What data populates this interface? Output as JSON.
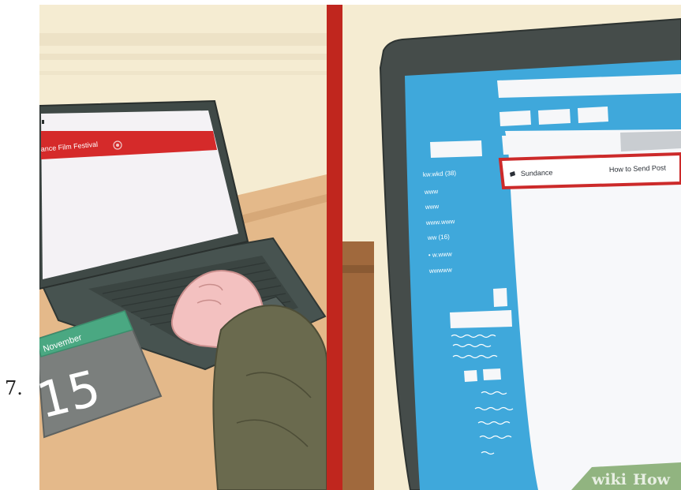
{
  "step_number": "7.",
  "left_panel": {
    "browser_title": "ance Film Festival",
    "calendar": {
      "month": "November",
      "day": "15"
    }
  },
  "right_panel": {
    "sidebar_items": [
      "kw.wkd (38)",
      "www",
      "www",
      "www.www",
      "ww (16)",
      "• w.www",
      "wwwww"
    ],
    "highlighted_row": {
      "sender": "Sundance",
      "subject": "How to Send Post"
    }
  },
  "watermark": {
    "brand_a": "wiki",
    "brand_b": "How"
  },
  "colors": {
    "divider": "#c0261e",
    "title_bar": "#d52a2a",
    "screen_blue": "#3fa8db",
    "highlight_border": "#cc2a2a",
    "calendar_green": "#4aa882",
    "calendar_gray": "#7b7f7d",
    "laptop_body": "#495552",
    "sleeve": "#6a6a4e",
    "skin": "#f3c1c0"
  }
}
